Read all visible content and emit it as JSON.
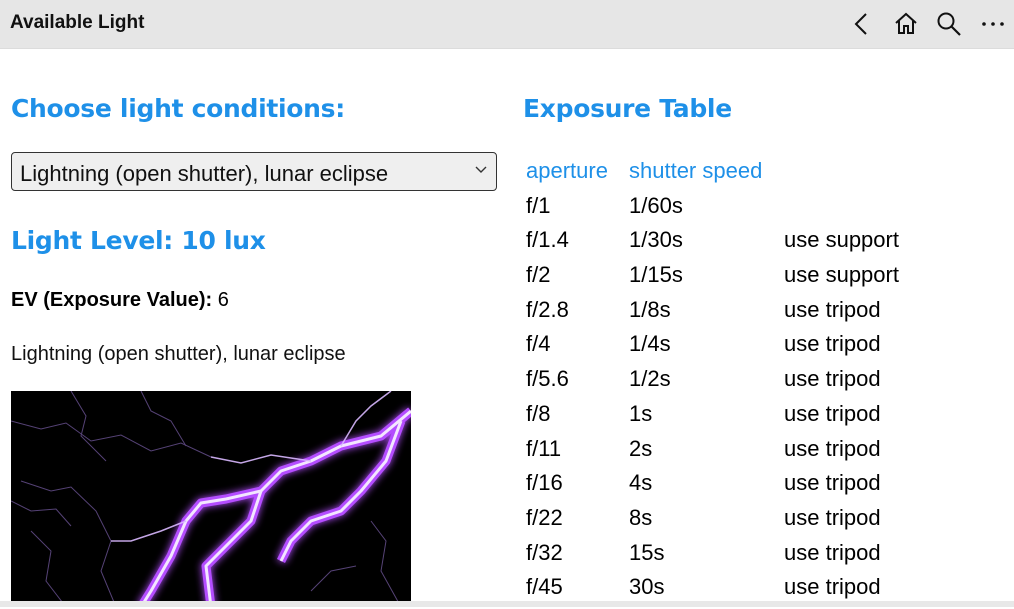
{
  "app": {
    "title": "Available Light",
    "toolbar": {
      "back_icon": "back-arrow-icon",
      "home_icon": "home-icon",
      "search_icon": "search-icon",
      "more_icon": "more-icon"
    }
  },
  "left": {
    "choose_heading": "Choose light conditions:",
    "selected_condition": "Lightning (open shutter), lunar eclipse",
    "light_level_heading": "Light Level: 10 lux",
    "ev_label": "EV (Exposure Value):",
    "ev_value": "6",
    "description": "Lightning (open shutter), lunar eclipse",
    "image_subject": "lightning-image"
  },
  "exposure": {
    "heading": "Exposure Table",
    "columns": [
      "aperture",
      "shutter speed",
      ""
    ],
    "rows": [
      [
        "f/1",
        "1/60s",
        ""
      ],
      [
        "f/1.4",
        "1/30s",
        "use support"
      ],
      [
        "f/2",
        "1/15s",
        "use support"
      ],
      [
        "f/2.8",
        "1/8s",
        "use tripod"
      ],
      [
        "f/4",
        "1/4s",
        "use tripod"
      ],
      [
        "f/5.6",
        "1/2s",
        "use tripod"
      ],
      [
        "f/8",
        "1s",
        "use tripod"
      ],
      [
        "f/11",
        "2s",
        "use tripod"
      ],
      [
        "f/16",
        "4s",
        "use tripod"
      ],
      [
        "f/22",
        "8s",
        "use tripod"
      ],
      [
        "f/32",
        "15s",
        "use tripod"
      ],
      [
        "f/45",
        "30s",
        "use tripod"
      ]
    ]
  },
  "colors": {
    "accent": "#1e90e8",
    "titlebar": "#e6e6e6",
    "lightning": "#b44dff"
  }
}
